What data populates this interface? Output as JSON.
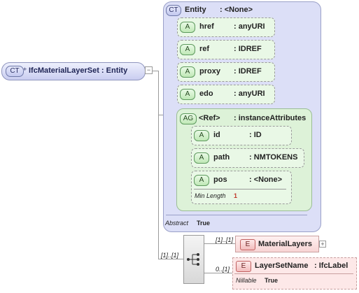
{
  "root": {
    "badge": "CT",
    "label": "IfcMaterialLayerSet : Entity"
  },
  "entity": {
    "badge": "CT",
    "name": "Entity",
    "type": ": <None>",
    "attributes": [
      {
        "badge": "A",
        "name": "href",
        "type": ": anyURI"
      },
      {
        "badge": "A",
        "name": "ref",
        "type": ": IDREF"
      },
      {
        "badge": "A",
        "name": "proxy",
        "type": ": IDREF"
      },
      {
        "badge": "A",
        "name": "edo",
        "type": ": anyURI"
      }
    ],
    "attribute_group": {
      "badge": "AG",
      "name": "<Ref>",
      "type": ": instanceAttributes",
      "attributes": [
        {
          "badge": "A",
          "name": "id",
          "type": ": ID"
        },
        {
          "badge": "A",
          "name": "path",
          "type": ": NMTOKENS"
        },
        {
          "badge": "A",
          "name": "pos",
          "type": ": <None>",
          "facet": {
            "label": "Min Length",
            "value": "1"
          }
        }
      ]
    },
    "abstract": {
      "label": "Abstract",
      "value": "True"
    }
  },
  "sequence": {
    "occurrence": "[1]..[1]"
  },
  "elements": [
    {
      "badge": "E",
      "name": "MaterialLayers",
      "occurrence": "[1]..[1]"
    },
    {
      "badge": "E",
      "name": "LayerSetName",
      "type": ": IfcLabel",
      "occurrence": "0..[1]",
      "nillable": {
        "label": "Nillable",
        "value": "True"
      }
    }
  ]
}
